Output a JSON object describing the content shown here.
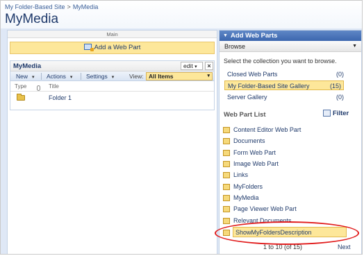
{
  "breadcrumb": {
    "site": "My Folder-Based Site",
    "sep": ">",
    "current": "MyMedia"
  },
  "page_title": "MyMedia",
  "zone": {
    "header": "Main",
    "add_web_part": "Add a Web Part"
  },
  "web_part": {
    "title": "MyMedia",
    "edit_label": "edit",
    "close_label": "×",
    "toolbar": {
      "new": "New",
      "actions": "Actions",
      "settings": "Settings",
      "view_label": "View:",
      "view_value": "All Items"
    },
    "columns": {
      "type": "Type",
      "title": "Title"
    },
    "rows": [
      {
        "title": "Folder 1"
      }
    ]
  },
  "panel": {
    "title": "Add Web Parts",
    "browse": "Browse",
    "description": "Select the collection you want to browse.",
    "collections": [
      {
        "label": "Closed Web Parts",
        "count": "(0)"
      },
      {
        "label": "My Folder-Based Site Gallery",
        "count": "(15)"
      },
      {
        "label": "Server Gallery",
        "count": "(0)"
      }
    ],
    "list_heading": "Web Part List",
    "filter_label": "Filter",
    "items": [
      "Content Editor Web Part",
      "Documents",
      "Form Web Part",
      "Image Web Part",
      "Links",
      "MyFolders",
      "MyMedia",
      "Page Viewer Web Part",
      "Relevant Documents",
      "ShowMyFoldersDescription"
    ],
    "pager": "1 to 10 (of 15)",
    "next": "Next"
  },
  "colors": {
    "accent": "#3c66ae",
    "highlight": "#fde79a",
    "annotation": "#e11b1b"
  }
}
